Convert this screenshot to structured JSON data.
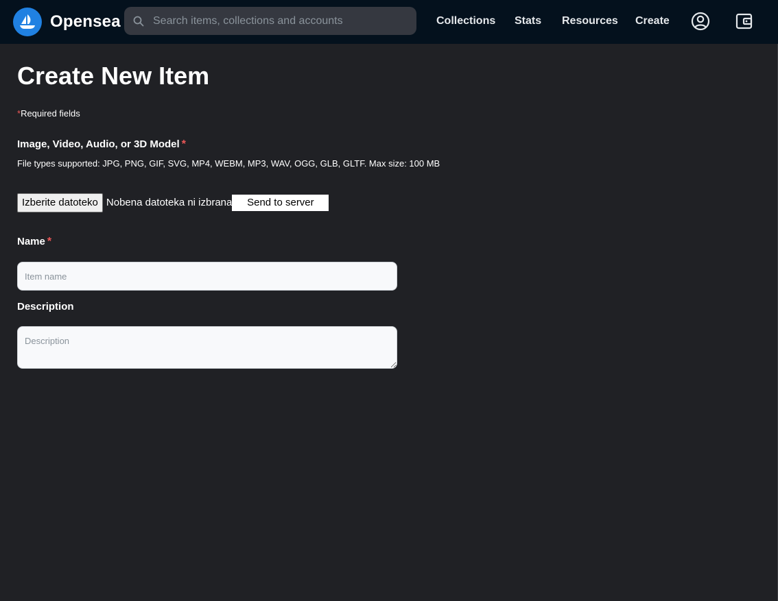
{
  "header": {
    "brand": "Opensea",
    "search_placeholder": "Search items, collections and accounts",
    "nav": {
      "collections": "Collections",
      "stats": "Stats",
      "resources": "Resources",
      "create": "Create"
    },
    "icons": {
      "logo": "opensea-logo-icon",
      "search": "search-icon",
      "account": "account-circle-icon",
      "wallet": "wallet-icon"
    }
  },
  "page": {
    "title": "Create New Item",
    "required_star": "*",
    "required_note": "Required fields"
  },
  "media": {
    "label": "Image, Video, Audio, or 3D Model",
    "star": "*",
    "file_types": "File types supported: JPG, PNG, GIF, SVG, MP4, WEBM, MP3, WAV, OGG, GLB, GLTF. Max size: 100 MB",
    "choose_button": "Izberite datoteko",
    "no_file_text": "Nobena datoteka ni izbrana",
    "send_button": "Send to server"
  },
  "name_field": {
    "label": "Name",
    "star": "*",
    "placeholder": "Item name",
    "value": ""
  },
  "description_field": {
    "label": "Description",
    "placeholder": "Description",
    "value": ""
  },
  "colors": {
    "nav_bg": "#04111d",
    "page_bg": "#202125",
    "accent": "#2081e2",
    "required": "#eb5757"
  }
}
